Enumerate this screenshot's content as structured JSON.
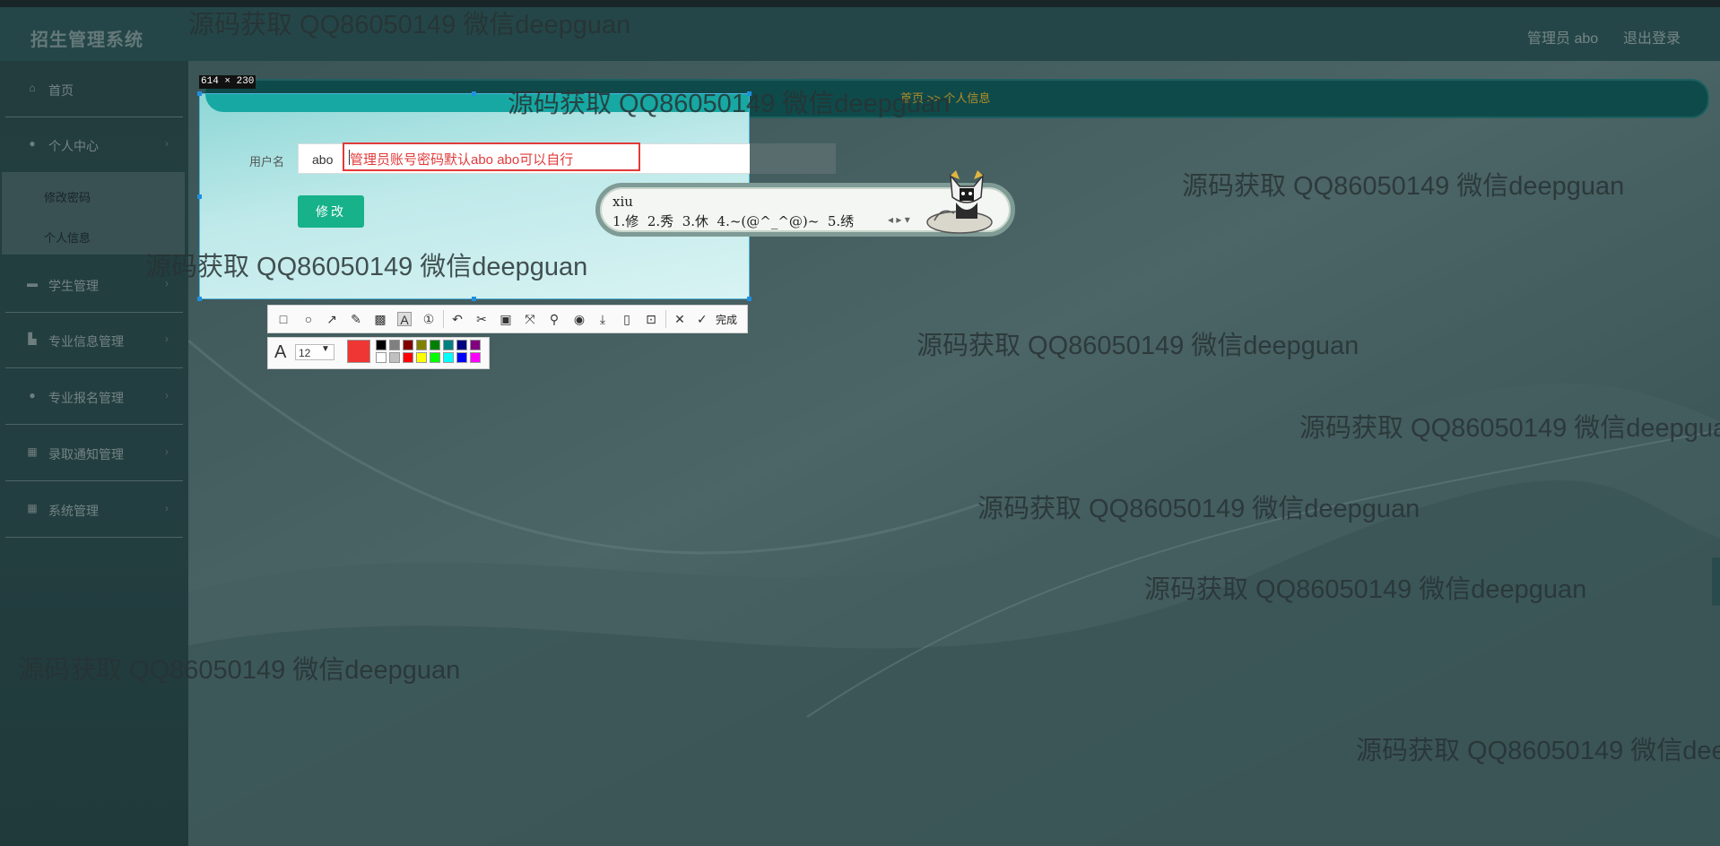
{
  "header": {
    "brand": "招生管理系统",
    "user_label": "管理员 abo",
    "logout_label": "退出登录"
  },
  "sidebar": {
    "items": [
      {
        "label": "首页",
        "icon": "home-icon"
      },
      {
        "label": "个人中心",
        "icon": "user-icon"
      },
      {
        "label": "学生管理",
        "icon": "briefcase-icon"
      },
      {
        "label": "专业信息管理",
        "icon": "bank-icon"
      },
      {
        "label": "专业报名管理",
        "icon": "location-icon"
      },
      {
        "label": "录取通知管理",
        "icon": "grid-icon"
      },
      {
        "label": "系统管理",
        "icon": "grid-icon"
      }
    ],
    "submenu": [
      "修改密码",
      "个人信息"
    ]
  },
  "breadcrumb": "首页 >> 个人信息",
  "form": {
    "username_label": "用户名",
    "username_value": "abo",
    "annotation_text": "管理员账号密码默认abo abo可以自行",
    "save_label": "修改"
  },
  "capture": {
    "size_label": "614 × 230",
    "done_label": "完成",
    "font_size": "12",
    "current_color": "#f03535",
    "palette": [
      "#000000",
      "#808080",
      "#800000",
      "#808000",
      "#008000",
      "#008080",
      "#000080",
      "#800080",
      "#ffffff",
      "#c0c0c0",
      "#ff0000",
      "#ffff00",
      "#00ff00",
      "#00ffff",
      "#0000ff",
      "#ff00ff"
    ]
  },
  "ime": {
    "input": "xiu",
    "candidates": "1.修  2.秀  3.休  4.~(@^_^@)~  5.绣"
  },
  "watermark": "源码获取 QQ86050149 微信deepguan"
}
